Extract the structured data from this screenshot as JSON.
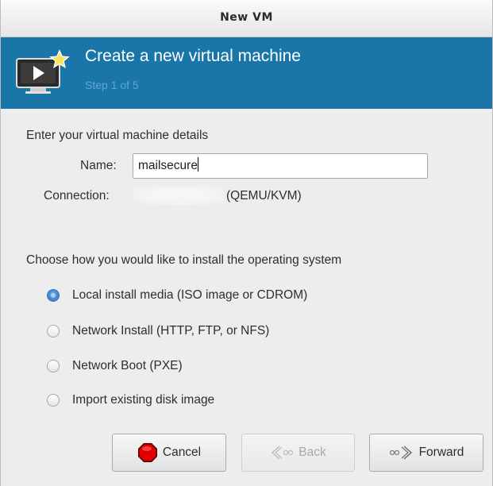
{
  "window": {
    "title": "New VM"
  },
  "banner": {
    "title": "Create a new virtual machine",
    "step": "Step 1 of 5",
    "icon": "vm-monitor-star-icon",
    "color": "#1a75a8"
  },
  "details": {
    "heading": "Enter your virtual machine details",
    "name_label": "Name:",
    "name_value": "mailsecure",
    "connection_label": "Connection:",
    "connection_value": "(QEMU/KVM)"
  },
  "install": {
    "heading": "Choose how you would like to install the operating system",
    "options": [
      {
        "label": "Local install media (ISO image or CDROM)",
        "checked": true
      },
      {
        "label": "Network Install (HTTP, FTP, or NFS)",
        "checked": false
      },
      {
        "label": "Network Boot (PXE)",
        "checked": false
      },
      {
        "label": "Import existing disk image",
        "checked": false
      }
    ]
  },
  "buttons": {
    "cancel": "Cancel",
    "back": "Back",
    "forward": "Forward"
  }
}
